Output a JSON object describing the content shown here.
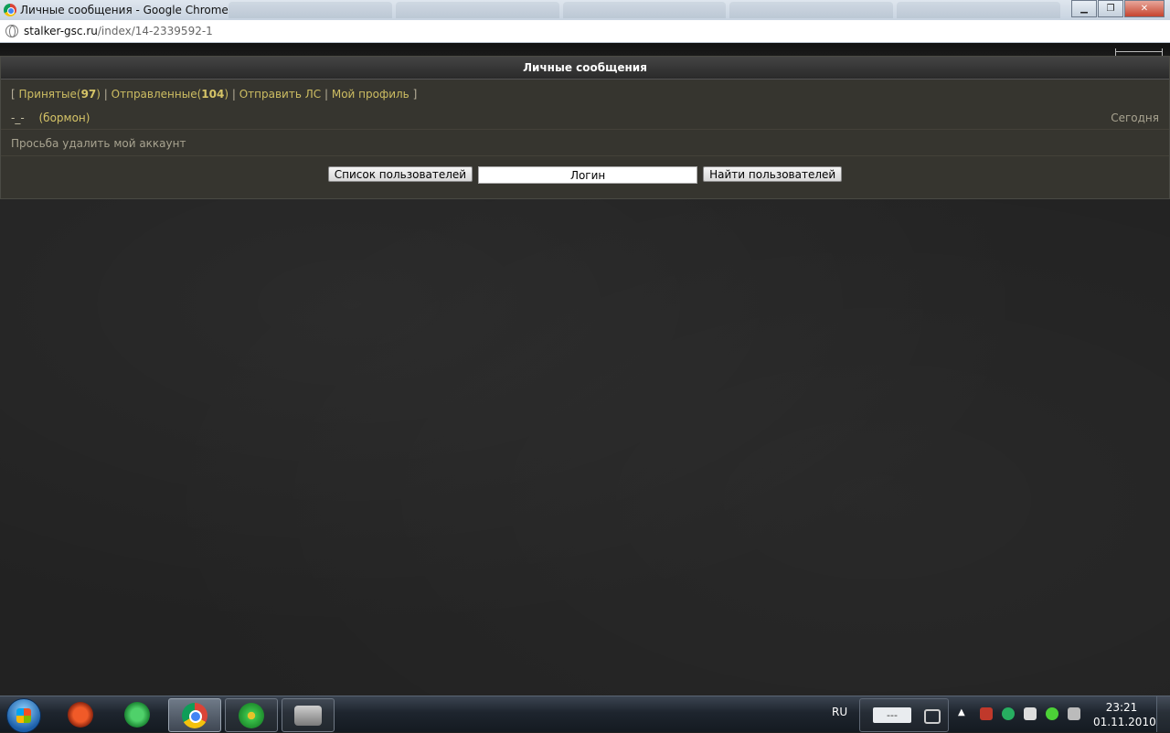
{
  "window": {
    "title": "Личные сообщения - Google Chrome"
  },
  "address": {
    "host": "stalker-gsc.ru",
    "path": "/index/14-2339592-1"
  },
  "pm": {
    "header": "Личные сообщения",
    "nav": {
      "open_bracket": "[",
      "inbox_label": "Принятые",
      "inbox_count": "97",
      "sent_label": "Отправленные",
      "sent_count": "104",
      "send_label": "Отправить ЛС",
      "profile_label": "Мой профиль",
      "close_bracket": "]",
      "separator": "|"
    },
    "message": {
      "sender": "-_-",
      "nick": "(бормон)",
      "date": "Сегодня",
      "subject": "Просьба удалить мой аккаунт"
    },
    "controls": {
      "user_list_button": "Список пользователей",
      "login_value": "Логин",
      "find_button": "Найти пользователей"
    }
  },
  "taskbar": {
    "language": "RU",
    "tray_mini": "---",
    "time": "23:21",
    "date": "01.11.2010"
  }
}
